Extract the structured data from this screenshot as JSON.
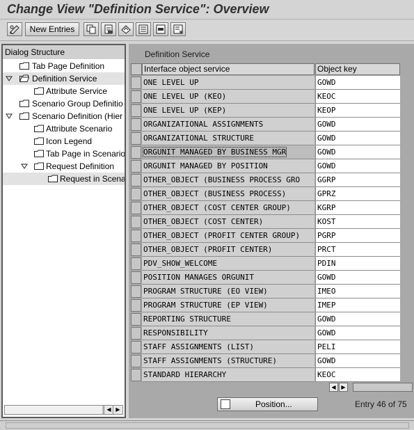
{
  "title": "Change View \"Definition Service\": Overview",
  "toolbar": {
    "new_entries_label": "New Entries"
  },
  "dialog": {
    "header": "Dialog Structure",
    "items": [
      {
        "label": "Tab Page Definition"
      },
      {
        "label": "Definition Service"
      },
      {
        "label": "Attribute Service"
      },
      {
        "label": "Scenario Group Definitio"
      },
      {
        "label": "Scenario Definition (Hier"
      },
      {
        "label": "Attribute Scenario"
      },
      {
        "label": "Icon Legend"
      },
      {
        "label": "Tab Page in Scenario"
      },
      {
        "label": "Request Definition"
      },
      {
        "label": "Request in Scena"
      }
    ]
  },
  "panel": {
    "title": "Definition Service",
    "columns": [
      "Interface object service",
      "Object key"
    ],
    "rows": [
      {
        "service": "ONE LEVEL UP",
        "key": "GOWD"
      },
      {
        "service": "ONE LEVEL UP (KEO)",
        "key": "KEOC"
      },
      {
        "service": "ONE LEVEL UP (KEP)",
        "key": "KEOP"
      },
      {
        "service": "ORGANIZATIONAL ASSIGNMENTS",
        "key": "GOWD"
      },
      {
        "service": "ORGANIZATIONAL STRUCTURE",
        "key": "GOWD"
      },
      {
        "service": "ORGUNIT MANAGED BY BUSINESS MGR",
        "key": "GOWD"
      },
      {
        "service": "ORGUNIT MANAGED BY POSITION",
        "key": "GOWD"
      },
      {
        "service": "OTHER_OBJECT (BUSINESS PROCESS GRO",
        "key": "GGRP"
      },
      {
        "service": "OTHER_OBJECT (BUSINESS PROCESS)",
        "key": "GPRZ"
      },
      {
        "service": "OTHER_OBJECT (COST CENTER GROUP)",
        "key": "KGRP"
      },
      {
        "service": "OTHER_OBJECT (COST CENTER)",
        "key": "KOST"
      },
      {
        "service": "OTHER_OBJECT (PROFIT CENTER GROUP)",
        "key": "PGRP"
      },
      {
        "service": "OTHER_OBJECT (PROFIT CENTER)",
        "key": "PRCT"
      },
      {
        "service": "PDV_SHOW_WELCOME",
        "key": "PDIN"
      },
      {
        "service": "POSITION MANAGES ORGUNIT",
        "key": "GOWD"
      },
      {
        "service": "PROGRAM STRUCTURE (EO VIEW)",
        "key": "IMEO"
      },
      {
        "service": "PROGRAM STRUCTURE (EP VIEW)",
        "key": "IMEP"
      },
      {
        "service": "REPORTING STRUCTURE",
        "key": "GOWD"
      },
      {
        "service": "RESPONSIBILITY",
        "key": "GOWD"
      },
      {
        "service": "STAFF ASSIGNMENTS (LIST)",
        "key": "PELI"
      },
      {
        "service": "STAFF ASSIGNMENTS (STRUCTURE)",
        "key": "GOWD"
      },
      {
        "service": "STANDARD HIERARCHY",
        "key": "KEOC"
      }
    ],
    "position_label": "Position...",
    "entry_text": "Entry 46 of 75"
  }
}
